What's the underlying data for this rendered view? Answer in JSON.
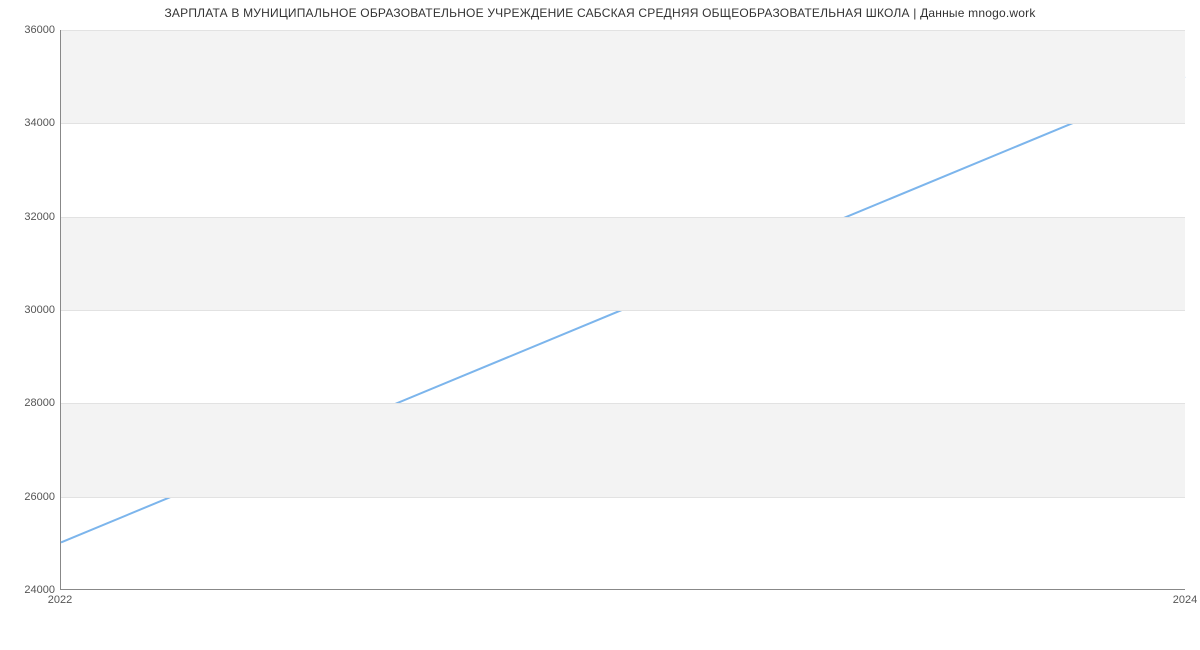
{
  "chart_data": {
    "type": "line",
    "title": "ЗАРПЛАТА В МУНИЦИПАЛЬНОЕ ОБРАЗОВАТЕЛЬНОЕ УЧРЕЖДЕНИЕ САБСКАЯ СРЕДНЯЯ ОБЩЕОБРАЗОВАТЕЛЬНАЯ ШКОЛА | Данные mnogo.work",
    "xlabel": "",
    "ylabel": "",
    "x": [
      2022,
      2024
    ],
    "series": [
      {
        "name": "Зарплата",
        "values": [
          25000,
          35000
        ],
        "color": "#7cb5ec"
      }
    ],
    "x_ticks": [
      2022,
      2024
    ],
    "y_ticks": [
      24000,
      26000,
      28000,
      30000,
      32000,
      34000,
      36000
    ],
    "xlim": [
      2022,
      2024
    ],
    "ylim": [
      24000,
      36000
    ],
    "grid": true
  }
}
